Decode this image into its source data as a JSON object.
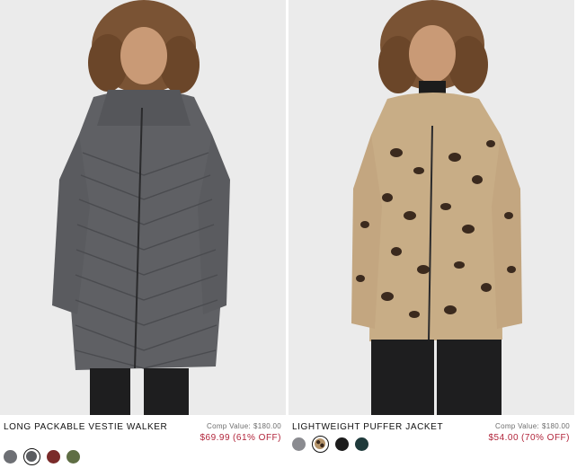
{
  "products": [
    {
      "name": "LONG PACKABLE VESTIE WALKER",
      "comp_label": "Comp Value:",
      "comp_value": "$180.00",
      "sale_price": "$69.99",
      "discount": "(61% OFF)",
      "image_alt": "Model wearing long gray packable puffer coat",
      "swatches": [
        {
          "color": "#6d6f74",
          "selected": false
        },
        {
          "color": "#5a5c60",
          "selected": true
        },
        {
          "color": "#7a2b2a",
          "selected": false
        },
        {
          "color": "#5f6e44",
          "selected": false
        }
      ]
    },
    {
      "name": "LIGHTWEIGHT PUFFER JACKET",
      "comp_label": "Comp Value:",
      "comp_value": "$180.00",
      "sale_price": "$54.00",
      "discount": "(70% OFF)",
      "image_alt": "Model wearing leopard print lightweight puffer jacket",
      "swatches": [
        {
          "color": "#8a8b90",
          "selected": false
        },
        {
          "color": "#9a7b52",
          "selected": true
        },
        {
          "color": "#1c1c1c",
          "selected": false
        },
        {
          "color": "#1f3a3b",
          "selected": false
        }
      ]
    }
  ],
  "colors": {
    "background": "#ffffff",
    "photo_bg": "#e9e9e9",
    "sale_price": "#b1243a",
    "comp_value": "#6d6d6d",
    "text": "#111111"
  }
}
